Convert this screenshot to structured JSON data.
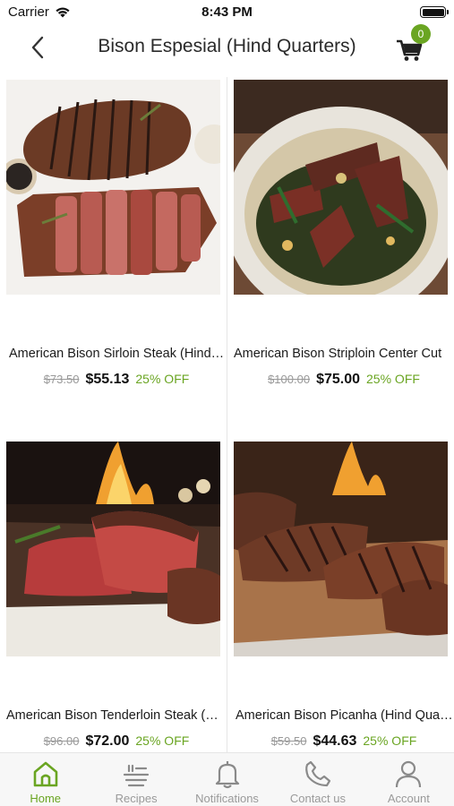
{
  "status_bar": {
    "carrier": "Carrier",
    "time": "8:43 PM"
  },
  "header": {
    "title": "Bison Espesial (Hind Quarters)",
    "cart_count": "0"
  },
  "products": [
    {
      "name": "American Bison Sirloin Steak (Hind Quarter)",
      "old_price": "$73.50",
      "price": "$55.13",
      "discount": "25% OFF",
      "image_icon": "grilled-sirloin-steak-photo"
    },
    {
      "name": "American Bison Striploin Center Cut",
      "old_price": "$100.00",
      "price": "$75.00",
      "discount": "25% OFF",
      "image_icon": "striploin-salad-bowl-photo"
    },
    {
      "name": "American Bison Tenderloin Steak (Hind Quarter)",
      "old_price": "$96.00",
      "price": "$72.00",
      "discount": "25% OFF",
      "image_icon": "tenderloin-grill-photo"
    },
    {
      "name": "American Bison Picanha (Hind Quarter)",
      "old_price": "$59.50",
      "price": "$44.63",
      "discount": "25% OFF",
      "image_icon": "picanha-grill-photo"
    }
  ],
  "tabs": [
    {
      "label": "Home",
      "icon": "home-icon",
      "active": true
    },
    {
      "label": "Recipes",
      "icon": "recipes-icon",
      "active": false
    },
    {
      "label": "Notifications",
      "icon": "bell-icon",
      "active": false
    },
    {
      "label": "Contact us",
      "icon": "phone-icon",
      "active": false
    },
    {
      "label": "Account",
      "icon": "user-icon",
      "active": false
    }
  ],
  "colors": {
    "accent": "#6aa522",
    "muted": "#9a9a9a",
    "price_old": "#999999"
  }
}
